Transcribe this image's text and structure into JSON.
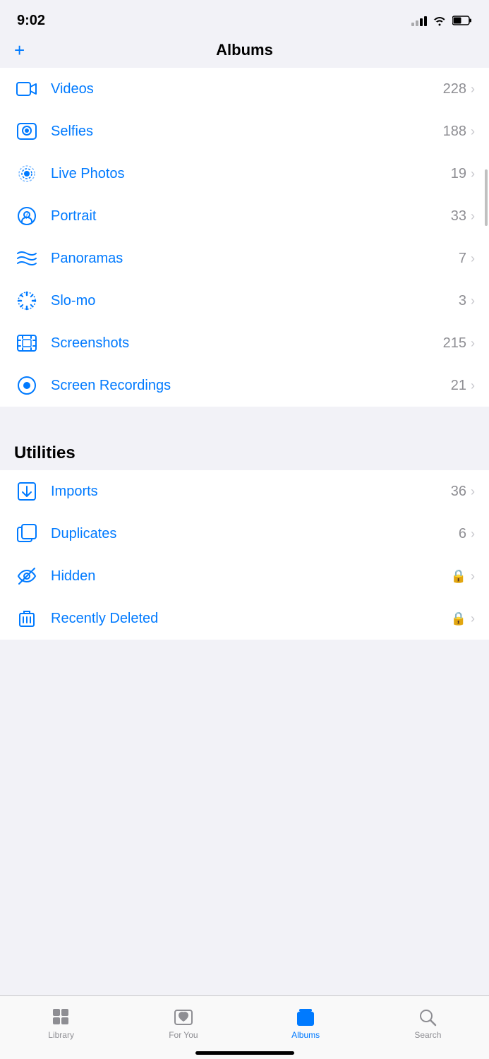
{
  "statusBar": {
    "time": "9:02",
    "signal": "2 bars",
    "wifi": "on",
    "battery": "half"
  },
  "header": {
    "title": "Albums",
    "addButton": "+"
  },
  "mediaTypes": {
    "sectionItems": [
      {
        "id": "videos",
        "label": "Videos",
        "count": "228",
        "icon": "video-icon"
      },
      {
        "id": "selfies",
        "label": "Selfies",
        "count": "188",
        "icon": "selfie-icon"
      },
      {
        "id": "live-photos",
        "label": "Live Photos",
        "count": "19",
        "icon": "live-photos-icon"
      },
      {
        "id": "portrait",
        "label": "Portrait",
        "count": "33",
        "icon": "portrait-icon"
      },
      {
        "id": "panoramas",
        "label": "Panoramas",
        "count": "7",
        "icon": "panorama-icon"
      },
      {
        "id": "slo-mo",
        "label": "Slo-mo",
        "count": "3",
        "icon": "slomo-icon"
      },
      {
        "id": "screenshots",
        "label": "Screenshots",
        "count": "215",
        "icon": "screenshot-icon"
      },
      {
        "id": "screen-recordings",
        "label": "Screen Recordings",
        "count": "21",
        "icon": "screen-recording-icon"
      }
    ]
  },
  "utilities": {
    "sectionTitle": "Utilities",
    "items": [
      {
        "id": "imports",
        "label": "Imports",
        "count": "36",
        "locked": false,
        "icon": "imports-icon"
      },
      {
        "id": "duplicates",
        "label": "Duplicates",
        "count": "6",
        "locked": false,
        "icon": "duplicates-icon"
      },
      {
        "id": "hidden",
        "label": "Hidden",
        "count": "",
        "locked": true,
        "icon": "hidden-icon"
      },
      {
        "id": "recently-deleted",
        "label": "Recently Deleted",
        "count": "",
        "locked": true,
        "icon": "recently-deleted-icon"
      }
    ]
  },
  "tabBar": {
    "items": [
      {
        "id": "library",
        "label": "Library",
        "active": false
      },
      {
        "id": "for-you",
        "label": "For You",
        "active": false
      },
      {
        "id": "albums",
        "label": "Albums",
        "active": true
      },
      {
        "id": "search",
        "label": "Search",
        "active": false
      }
    ]
  },
  "colors": {
    "blue": "#007aff",
    "gray": "#8e8e93",
    "separator": "#c6c6c8"
  }
}
